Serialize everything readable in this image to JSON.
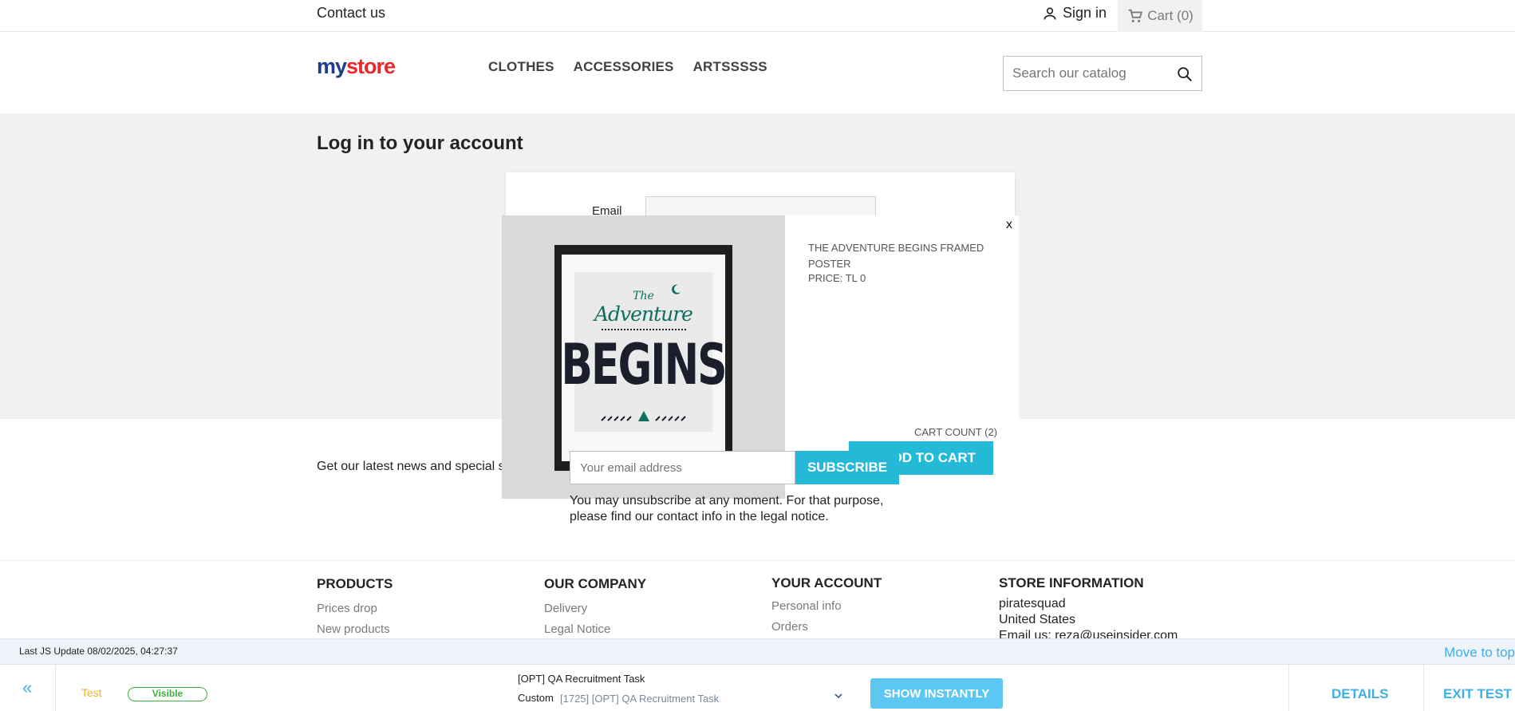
{
  "topbar": {
    "contact": "Contact us",
    "signin": "Sign in",
    "cart": "Cart (0)"
  },
  "header": {
    "logo": {
      "my": "my",
      "store": "store"
    },
    "nav": [
      "CLOTHES",
      "ACCESSORIES",
      "ARTSSSSS"
    ],
    "search_placeholder": "Search our catalog"
  },
  "main": {
    "title": "Log in to your account",
    "email_label": "Email"
  },
  "newsletter": {
    "text": "Get our latest news and special sales",
    "placeholder": "Your email address",
    "button": "SUBSCRIBE",
    "note": "You may unsubscribe at any moment. For that purpose, please find our contact info in the legal notice."
  },
  "footer": {
    "products": {
      "title": "PRODUCTS",
      "links": [
        "Prices drop",
        "New products"
      ]
    },
    "company": {
      "title": "OUR COMPANY",
      "links": [
        "Delivery",
        "Legal Notice"
      ]
    },
    "account": {
      "title": "YOUR ACCOUNT",
      "links": [
        "Personal info",
        "Orders"
      ]
    },
    "store": {
      "title": "STORE INFORMATION",
      "lines": [
        "piratesquad",
        "United States",
        "Email us: reza@useinsider.com"
      ]
    }
  },
  "popup": {
    "close": "x",
    "product_title": "THE ADVENTURE BEGINS FRAMED POSTER",
    "price": "PRICE: TL 0",
    "cart_count": "CART COUNT (2)",
    "add_to_cart": "ADD TO CART",
    "art": {
      "the": "The",
      "adventure": "Adventure",
      "begins": "BEGINS"
    }
  },
  "testbar": {
    "last_update": "Last JS Update 08/02/2025, 04:27:37",
    "move_to_top": "Move to top",
    "back": "«",
    "test": "Test",
    "visible": "Visible",
    "task_title": "[OPT] QA Recruitment Task",
    "custom": "Custom",
    "task_select": "[1725] [OPT] QA Recruitment Task",
    "show_instantly": "SHOW INSTANTLY",
    "details": "DETAILS",
    "exit": "EXIT TEST"
  },
  "colors": {
    "accent": "#24b9d7",
    "link_blue": "#3fb0e5",
    "test_yellow": "#e7b531",
    "visible_green": "#3db13d",
    "poster_green": "#0f6e5e"
  }
}
